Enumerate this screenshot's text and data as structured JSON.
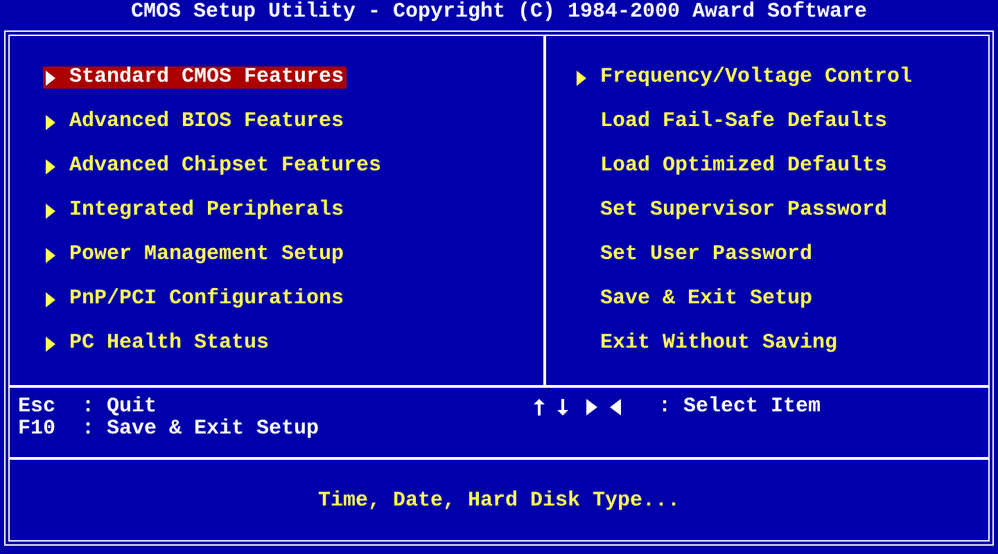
{
  "title": "CMOS Setup Utility - Copyright (C) 1984-2000 Award Software",
  "left_menu": [
    {
      "label": "Standard CMOS Features",
      "submenu": true,
      "selected": true
    },
    {
      "label": "Advanced BIOS Features",
      "submenu": true,
      "selected": false
    },
    {
      "label": "Advanced Chipset Features",
      "submenu": true,
      "selected": false
    },
    {
      "label": "Integrated Peripherals",
      "submenu": true,
      "selected": false
    },
    {
      "label": "Power Management Setup",
      "submenu": true,
      "selected": false
    },
    {
      "label": "PnP/PCI Configurations",
      "submenu": true,
      "selected": false
    },
    {
      "label": "PC Health Status",
      "submenu": true,
      "selected": false
    }
  ],
  "right_menu": [
    {
      "label": "Frequency/Voltage Control",
      "submenu": true,
      "selected": false
    },
    {
      "label": "Load Fail-Safe Defaults",
      "submenu": false,
      "selected": false
    },
    {
      "label": "Load Optimized Defaults",
      "submenu": false,
      "selected": false
    },
    {
      "label": "Set Supervisor Password",
      "submenu": false,
      "selected": false
    },
    {
      "label": "Set User Password",
      "submenu": false,
      "selected": false
    },
    {
      "label": "Save & Exit Setup",
      "submenu": false,
      "selected": false
    },
    {
      "label": "Exit Without Saving",
      "submenu": false,
      "selected": false
    }
  ],
  "legend_left": [
    {
      "kind": "key",
      "key": "Esc",
      "action": ": Quit"
    },
    {
      "kind": "key",
      "key": "F10",
      "action": ": Save & Exit Setup"
    }
  ],
  "legend_right": [
    {
      "kind": "arrows",
      "action": ": Select Item"
    }
  ],
  "help": "Time, Date, Hard Disk Type..."
}
